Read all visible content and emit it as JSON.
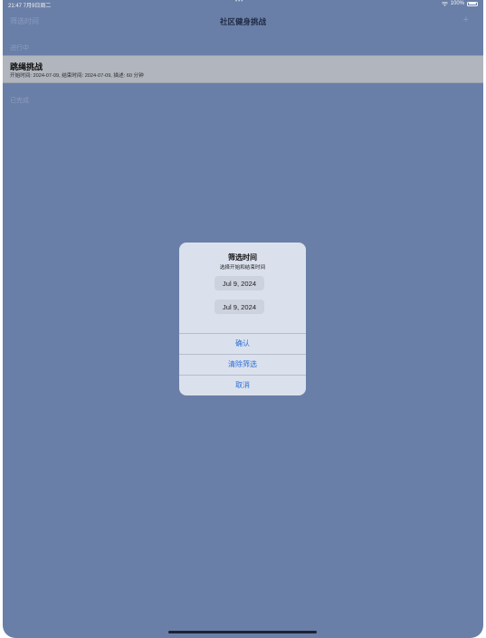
{
  "status_bar": {
    "time": "21:47  7月9日周二",
    "dots": "•••",
    "battery_text": "100%"
  },
  "nav": {
    "left_label": "筛选时间",
    "title": "社区健身挑战",
    "right_label": "+"
  },
  "sections": {
    "in_progress": "进行中",
    "completed": "已完成"
  },
  "list": {
    "items": [
      {
        "title": "跳绳挑战",
        "subtitle": "开始时间: 2024-07-09, 结束时间: 2024-07-09, 描述: 60 分钟"
      }
    ]
  },
  "alert": {
    "title": "筛选时间",
    "message": "选择开始和结束时间",
    "start_date": "Jul 9, 2024",
    "end_date": "Jul 9, 2024",
    "confirm_label": "确认",
    "clear_label": "清除筛选",
    "cancel_label": "取消"
  },
  "colors": {
    "background": "#6a7fa7",
    "accent": "#2e6fd8",
    "alert_background": "#dbe1ec"
  }
}
